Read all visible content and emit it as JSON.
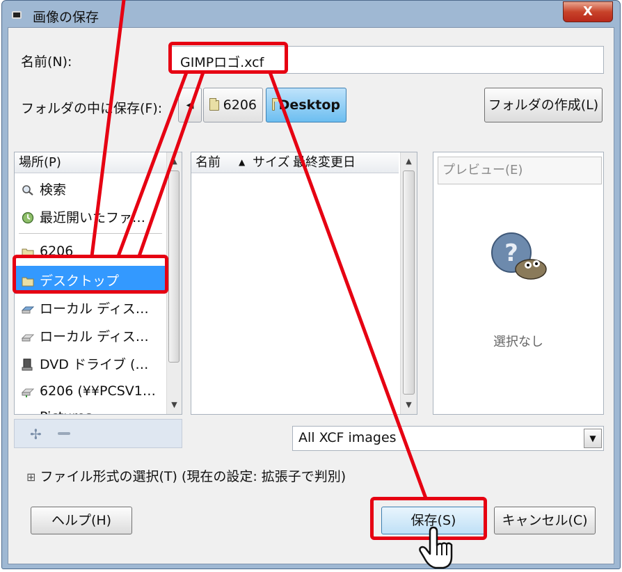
{
  "window": {
    "title": "画像の保存",
    "close_label": "X"
  },
  "name_row": {
    "label": "名前(N):",
    "value": "GIMPロゴ.xcf"
  },
  "folder_row": {
    "label": "フォルダの中に保存(F):",
    "nav_arrow": "◀",
    "crumbs": [
      "6206",
      "Desktop"
    ],
    "create_folder_label": "フォルダの作成(L)"
  },
  "places": {
    "header": "場所(P)",
    "items": [
      {
        "label": "検索",
        "icon": "search-icon"
      },
      {
        "label": "最近開いたファ…",
        "icon": "recent-icon"
      },
      {
        "label": "6206",
        "icon": "folder-icon"
      },
      {
        "label": "デスクトップ",
        "icon": "folder-icon",
        "selected": true
      },
      {
        "label": "ローカル ディス…",
        "icon": "drive-icon"
      },
      {
        "label": "ローカル ディス…",
        "icon": "drive-icon"
      },
      {
        "label": "DVD ドライブ (…",
        "icon": "dvd-icon"
      },
      {
        "label": "6206 (¥¥PCSV1…",
        "icon": "network-drive-icon"
      },
      {
        "label": "Pictures",
        "icon": "folder-icon"
      }
    ]
  },
  "files": {
    "columns": [
      "名前",
      "サイズ",
      "最終変更日"
    ],
    "sort_indicator": "▲"
  },
  "preview": {
    "label": "プレビュー(E)",
    "empty_text": "選択なし"
  },
  "filter": {
    "value": "All XCF images"
  },
  "file_type": {
    "expander": "⊞",
    "label": "ファイル形式の選択(T) (現在の設定: 拡張子で判別)"
  },
  "buttons": {
    "help": "ヘルプ(H)",
    "save": "保存(S)",
    "cancel": "キャンセル(C)"
  },
  "colors": {
    "annotation": "#e60012",
    "selection": "#3399ff"
  }
}
